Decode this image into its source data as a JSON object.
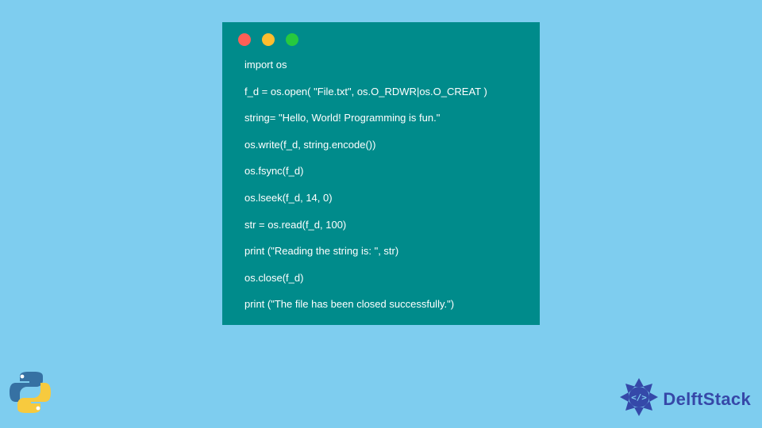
{
  "code_window": {
    "traffic_lights": [
      "red",
      "yellow",
      "green"
    ],
    "lines": [
      "import os",
      "f_d = os.open( \"File.txt\", os.O_RDWR|os.O_CREAT )",
      "string= \"Hello, World! Programming is fun.\"",
      "os.write(f_d, string.encode())",
      "os.fsync(f_d)",
      "os.lseek(f_d, 14, 0)",
      "str = os.read(f_d, 100)",
      "print (\"Reading the string is: \", str)",
      "os.close(f_d)",
      "print (\"The file has been closed successfully.\")"
    ]
  },
  "branding": {
    "delftstack_label": "DelftStack"
  },
  "icons": {
    "python": "python-logo",
    "delftstack": "delftstack-logo"
  }
}
